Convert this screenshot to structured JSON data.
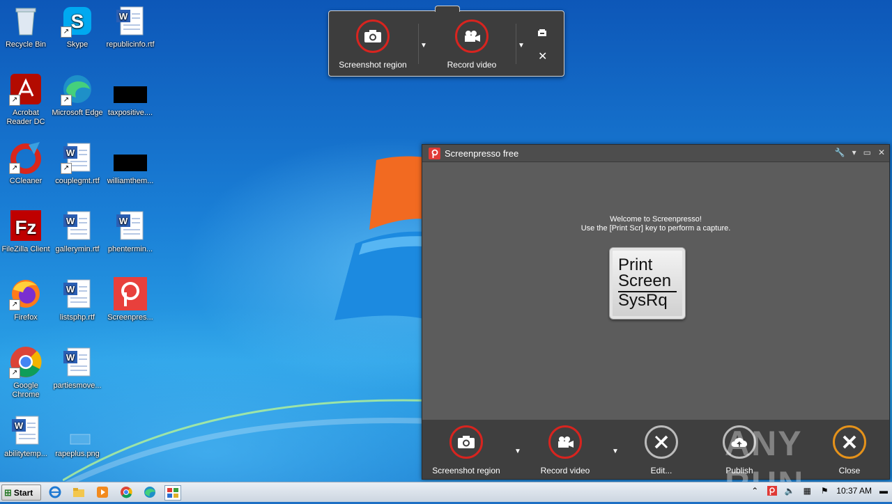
{
  "desktop_icons": [
    {
      "label": "Recycle Bin",
      "icon": "recycle-bin-icon"
    },
    {
      "label": "Skype",
      "icon": "skype-icon"
    },
    {
      "label": "republicinfo.rtf",
      "icon": "word-doc-icon"
    },
    {
      "label": "Acrobat Reader DC",
      "label_line1": "Acrobat",
      "label_line2": "Reader DC",
      "icon": "acrobat-icon"
    },
    {
      "label": "Microsoft Edge",
      "icon": "edge-icon"
    },
    {
      "label": "taxpositive....",
      "icon": "black-thumbnail-icon"
    },
    {
      "label": "CCleaner",
      "icon": "ccleaner-icon"
    },
    {
      "label": "couplegmt.rtf",
      "icon": "word-doc-icon"
    },
    {
      "label": "williamthem...",
      "icon": "black-thumbnail-icon"
    },
    {
      "label": "FileZilla Client",
      "icon": "filezilla-icon"
    },
    {
      "label": "gallerymin.rtf",
      "icon": "word-doc-icon"
    },
    {
      "label": "phentermin...",
      "icon": "word-doc-icon"
    },
    {
      "label": "Firefox",
      "icon": "firefox-icon"
    },
    {
      "label": "listsphp.rtf",
      "icon": "word-doc-icon"
    },
    {
      "label": "Screenpres...",
      "icon": "screenpresso-icon"
    },
    {
      "label": "Google Chrome",
      "label_line1": "Google",
      "label_line2": "Chrome",
      "icon": "chrome-icon"
    },
    {
      "label": "partiesmove...",
      "icon": "word-doc-icon"
    },
    {
      "label": "abilitytemp...",
      "icon": "word-doc-icon"
    },
    {
      "label": "rapeplus.png",
      "icon": "png-file-icon"
    }
  ],
  "capture_bar": {
    "screenshot_label": "Screenshot region",
    "record_label": "Record video"
  },
  "screenpresso": {
    "title": "Screenpresso free",
    "welcome_line1": "Welcome to Screenpresso!",
    "welcome_line2": "Use the [Print Scr] key to perform a capture.",
    "key_line1": "Print",
    "key_line2": "Screen",
    "key_line3": "SysRq",
    "bottom": {
      "screenshot_label": "Screenshot region",
      "record_label": "Record video",
      "edit_label": "Edit...",
      "publish_label": "Publish",
      "close_label": "Close"
    }
  },
  "taskbar": {
    "start_label": "Start",
    "clock": "10:37 AM"
  },
  "watermark": "ANY RUN",
  "colors": {
    "accent_red": "#d8241f",
    "close_orange": "#e5921a",
    "dark_panel": "#3f3f3f"
  }
}
